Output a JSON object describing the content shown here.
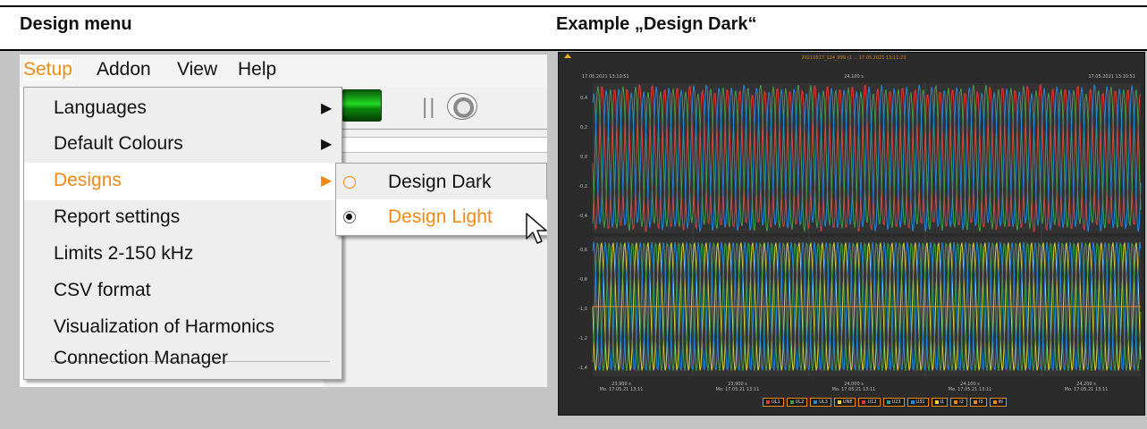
{
  "headings": {
    "left": "Design menu",
    "right": "Example „Design Dark“"
  },
  "menubar": {
    "items": [
      "Setup",
      "Addon",
      "View",
      "Help"
    ],
    "active": "Setup"
  },
  "toolbar": {
    "icons": [
      "green-button-icon",
      "separator-bars-icon",
      "eject-disc-icon"
    ],
    "separator": "||"
  },
  "setup_menu": {
    "items": [
      {
        "label": "Languages",
        "submenu": true
      },
      {
        "label": "Default Colours",
        "submenu": true
      },
      {
        "label": "Designs",
        "submenu": true,
        "highlighted": true
      },
      {
        "label": "Report settings"
      },
      {
        "label": "Limits 2-150 kHz"
      },
      {
        "label": "CSV format"
      },
      {
        "label": "Visualization of Harmonics"
      },
      {
        "label": "Connection Manager"
      }
    ]
  },
  "designs_submenu": {
    "items": [
      {
        "label": "Design Dark",
        "selected": false
      },
      {
        "label": "Design Light",
        "selected": true,
        "highlighted": true
      }
    ]
  },
  "dark_example": {
    "title": "20210517_124_999 (1 ... 17.05.2021 13:11:23",
    "top_left_stamp": "17.05.2021 13:10:51",
    "top_mid_stamp": "24,100 s",
    "top_right_stamp": "17.05.2021 13:10:51",
    "y_ticks_upper": [
      "0,4",
      "0,2",
      "0,0",
      "-0,2",
      "-0,4"
    ],
    "y_ticks_lower": [
      "-0,6",
      "-0,8",
      "-1,0",
      "-1,2",
      "-1,4"
    ],
    "x_ticks": [
      {
        "value": "23,900 s",
        "date": "Mo. 17.05.21 13:11"
      },
      {
        "value": "23,900 s",
        "date": "Mo. 17.05.21 13:11"
      },
      {
        "value": "24,000 s",
        "date": "Mo. 17.05.21 13:11"
      },
      {
        "value": "24,100 s",
        "date": "Mo. 17.05.21 13:11"
      },
      {
        "value": "24,200 s",
        "date": "Mo. 17.05.21 13:11"
      }
    ],
    "legend": [
      {
        "label": "UL1",
        "color": "#e53935"
      },
      {
        "label": "UL2",
        "color": "#43a047"
      },
      {
        "label": "UL3",
        "color": "#1e88e5"
      },
      {
        "label": "UNE",
        "color": "#fdd835"
      },
      {
        "label": "U12",
        "color": "#e53935"
      },
      {
        "label": "U23",
        "color": "#26a69a"
      },
      {
        "label": "U31",
        "color": "#1e88e5"
      },
      {
        "label": "I1",
        "color": "#fdd835"
      },
      {
        "label": "I2",
        "color": "#f08a16"
      },
      {
        "label": "I3",
        "color": "#f08a16"
      },
      {
        "label": "IN",
        "color": "#f08a16"
      }
    ],
    "colors": {
      "background": "#2b2b2b",
      "plot_bg": "#333333",
      "red": "#e53935",
      "green": "#43a047",
      "blue": "#1e88e5",
      "yellow": "#d4d43a",
      "orange": "#f08a16"
    }
  },
  "accent_color": "#f08a16"
}
